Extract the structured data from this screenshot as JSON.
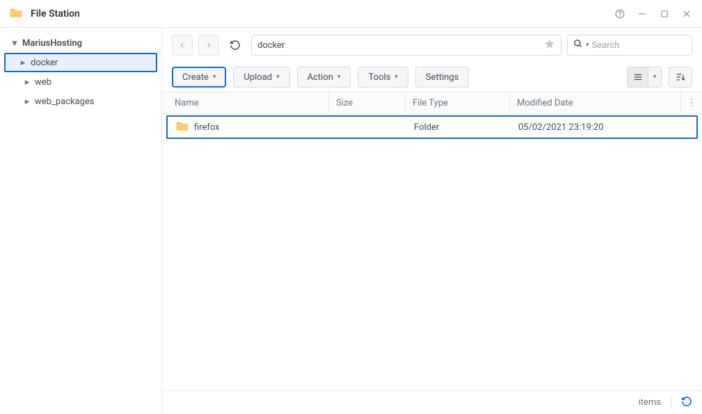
{
  "titlebar": {
    "title": "File Station"
  },
  "sidebar": {
    "root": "MariusHosting",
    "items": [
      {
        "label": "docker",
        "selected": true
      },
      {
        "label": "web",
        "selected": false
      },
      {
        "label": "web_packages",
        "selected": false
      }
    ]
  },
  "toolbar": {
    "path": "docker",
    "search_placeholder": "Search",
    "create": "Create",
    "upload": "Upload",
    "action": "Action",
    "tools": "Tools",
    "settings": "Settings"
  },
  "columns": {
    "name": "Name",
    "size": "Size",
    "type": "File Type",
    "date": "Modified Date"
  },
  "rows": [
    {
      "name": "firefox",
      "size": "",
      "type": "Folder",
      "date": "05/02/2021 23:19:20"
    }
  ],
  "statusbar": {
    "items_label": "items"
  }
}
